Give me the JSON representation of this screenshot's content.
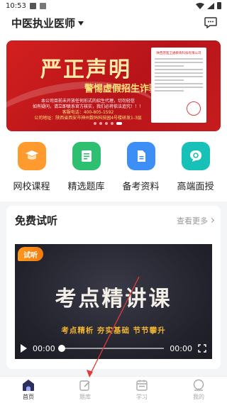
{
  "status_bar": {
    "time": "10:53"
  },
  "header": {
    "title": "中医执业医师"
  },
  "banner": {
    "title": "严正声明",
    "subtitle": "警惕虚假招生诈骗",
    "lines": [
      "本公司目前未开放任何形式的招生代理，切勿轻信",
      "如有疑问，请立即联系官方核实，我们必将依法追究！！！",
      "客服电话：400-805-1592",
      "公司地址：陕西省西安市神州数码科技园4号楼研发1-3层"
    ],
    "doc_heading": "陕西普医卫通教育科技有限公司"
  },
  "quick_nav": [
    {
      "label": "网校课程",
      "icon": "course-cap-icon",
      "color": "#ff9a2e"
    },
    {
      "label": "精选题库",
      "icon": "question-bank-icon",
      "color": "#2fbf71"
    },
    {
      "label": "备考资料",
      "icon": "document-icon",
      "color": "#3d8ef5"
    },
    {
      "label": "高端面授",
      "icon": "chat-bubble-icon",
      "color": "#18c1b8"
    }
  ],
  "trial": {
    "title": "免费试听",
    "more": "查看更多",
    "video": {
      "tag": "试听",
      "title": "考点精讲课",
      "subtitle": "考点精析  夯实基础  节节攀升",
      "current_time": "00:00",
      "duration": "00:00",
      "progress": 0
    }
  },
  "tabbar": [
    {
      "label": "首页",
      "icon": "home-icon",
      "active": true
    },
    {
      "label": "题库",
      "icon": "edit-icon",
      "active": false
    },
    {
      "label": "学习",
      "icon": "calendar-icon",
      "active": false
    },
    {
      "label": "我的",
      "icon": "user-icon",
      "active": false
    }
  ],
  "colors": {
    "banner_red": "#c61c1e",
    "accent_orange": "#f07b10",
    "annotation_red": "#e03a3a"
  }
}
